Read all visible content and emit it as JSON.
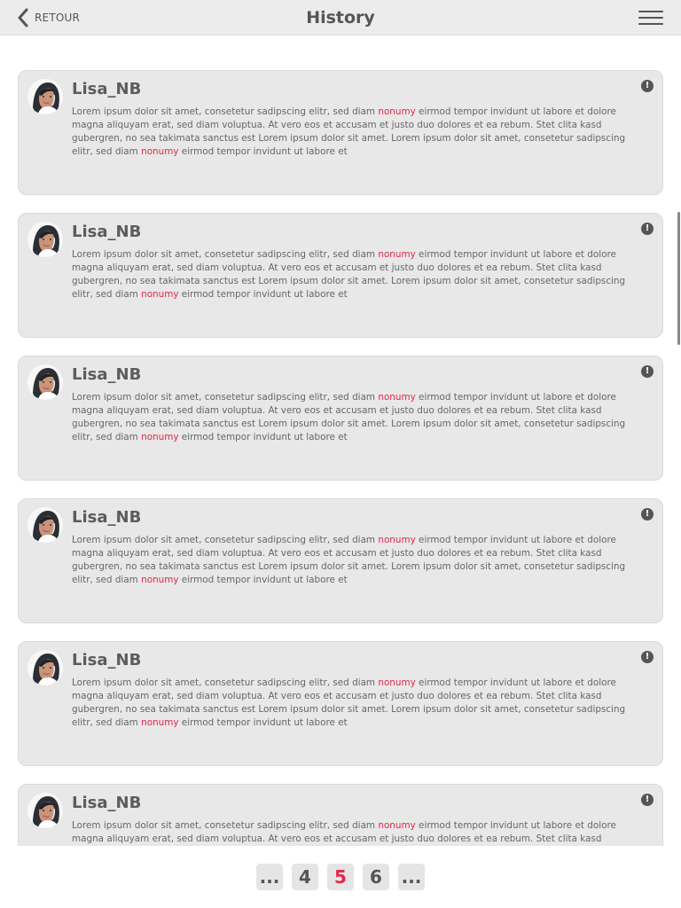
{
  "header": {
    "back_label": "RETOUR",
    "title": "History",
    "back_icon": "chevron-left-icon",
    "menu_icon": "hamburger-menu-icon"
  },
  "history": {
    "items": [
      {
        "username": "Lisa_NB",
        "avatar_icon": "avatar-image",
        "report_icon": "exclamation-icon",
        "report_label": "!",
        "message": {
          "part1": "Lorem ipsum dolor sit amet, consetetur sadipscing elitr, sed diam ",
          "highlight1": "nonumy",
          "part2": " eirmod tempor invidunt ut labore et dolore magna aliquyam erat, sed diam voluptua. At vero eos et accusam et justo duo dolores et ea rebum. Stet clita kasd gubergren, no sea takimata sanctus est Lorem ipsum dolor sit amet. Lorem ipsum dolor sit amet, consetetur sadipscing elitr, sed diam ",
          "highlight2": "nonumy",
          "part3": " eirmod tempor invidunt ut labore et"
        }
      },
      {
        "username": "Lisa_NB",
        "avatar_icon": "avatar-image",
        "report_icon": "exclamation-icon",
        "report_label": "!",
        "message": {
          "part1": "Lorem ipsum dolor sit amet, consetetur sadipscing elitr, sed diam ",
          "highlight1": "nonumy",
          "part2": " eirmod tempor invidunt ut labore et dolore magna aliquyam erat, sed diam voluptua. At vero eos et accusam et justo duo dolores et ea rebum. Stet clita kasd gubergren, no sea takimata sanctus est Lorem ipsum dolor sit amet. Lorem ipsum dolor sit amet, consetetur sadipscing elitr, sed diam ",
          "highlight2": "nonumy",
          "part3": " eirmod tempor invidunt ut labore et"
        }
      },
      {
        "username": "Lisa_NB",
        "avatar_icon": "avatar-image",
        "report_icon": "exclamation-icon",
        "report_label": "!",
        "message": {
          "part1": "Lorem ipsum dolor sit amet, consetetur sadipscing elitr, sed diam ",
          "highlight1": "nonumy",
          "part2": " eirmod tempor invidunt ut labore et dolore magna aliquyam erat, sed diam voluptua. At vero eos et accusam et justo duo dolores et ea rebum. Stet clita kasd gubergren, no sea takimata sanctus est Lorem ipsum dolor sit amet. Lorem ipsum dolor sit amet, consetetur sadipscing elitr, sed diam ",
          "highlight2": "nonumy",
          "part3": " eirmod tempor invidunt ut labore et"
        }
      },
      {
        "username": "Lisa_NB",
        "avatar_icon": "avatar-image",
        "report_icon": "exclamation-icon",
        "report_label": "!",
        "message": {
          "part1": "Lorem ipsum dolor sit amet, consetetur sadipscing elitr, sed diam ",
          "highlight1": "nonumy",
          "part2": " eirmod tempor invidunt ut labore et dolore magna aliquyam erat, sed diam voluptua. At vero eos et accusam et justo duo dolores et ea rebum. Stet clita kasd gubergren, no sea takimata sanctus est Lorem ipsum dolor sit amet. Lorem ipsum dolor sit amet, consetetur sadipscing elitr, sed diam ",
          "highlight2": "nonumy",
          "part3": " eirmod tempor invidunt ut labore et"
        }
      },
      {
        "username": "Lisa_NB",
        "avatar_icon": "avatar-image",
        "report_icon": "exclamation-icon",
        "report_label": "!",
        "message": {
          "part1": "Lorem ipsum dolor sit amet, consetetur sadipscing elitr, sed diam ",
          "highlight1": "nonumy",
          "part2": " eirmod tempor invidunt ut labore et dolore magna aliquyam erat, sed diam voluptua. At vero eos et accusam et justo duo dolores et ea rebum. Stet clita kasd gubergren, no sea takimata sanctus est Lorem ipsum dolor sit amet. Lorem ipsum dolor sit amet, consetetur sadipscing elitr, sed diam ",
          "highlight2": "nonumy",
          "part3": " eirmod tempor invidunt ut labore et"
        }
      },
      {
        "username": "Lisa_NB",
        "avatar_icon": "avatar-image",
        "report_icon": "exclamation-icon",
        "report_label": "!",
        "message": {
          "part1": "Lorem ipsum dolor sit amet, consetetur sadipscing elitr, sed diam ",
          "highlight1": "nonumy",
          "part2": " eirmod tempor invidunt ut labore et dolore magna aliquyam erat, sed diam voluptua. At vero eos et accusam et justo duo dolores et ea rebum. Stet clita kasd",
          "highlight2": "",
          "part3": ""
        }
      }
    ]
  },
  "pagination": {
    "pages": [
      {
        "label": "...",
        "active": false
      },
      {
        "label": "4",
        "active": false
      },
      {
        "label": "5",
        "active": true
      },
      {
        "label": "6",
        "active": false
      },
      {
        "label": "...",
        "active": false
      }
    ]
  },
  "colors": {
    "accent": "#df294a",
    "card_background": "#e8e8e8",
    "header_background": "#ececec",
    "text": "#555555"
  }
}
